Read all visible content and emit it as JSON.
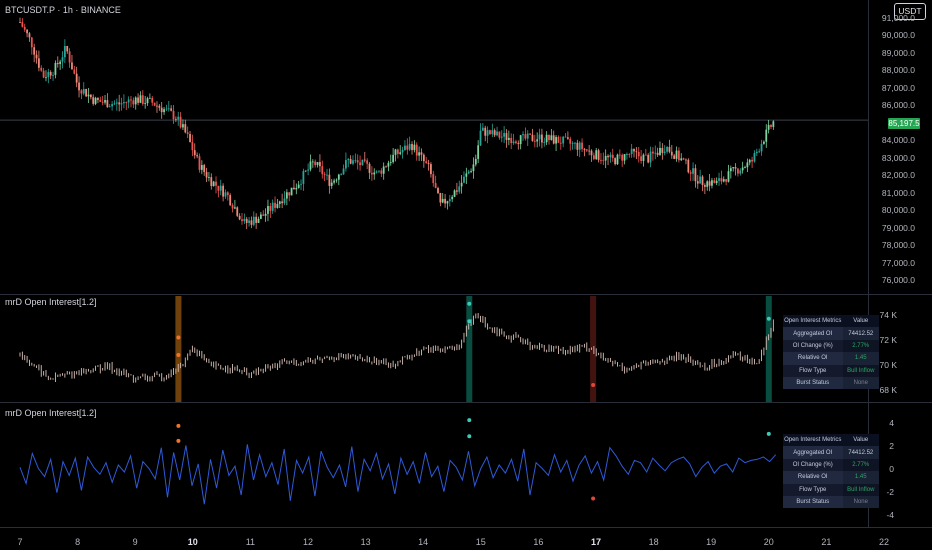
{
  "main": {
    "symbol_title": "BTCUSDT.P · 1h · BINANCE",
    "currency": "USDT",
    "last_price": "85,197.5",
    "price_ticks": [
      "91,000.0",
      "90,000.0",
      "89,000.0",
      "88,000.0",
      "87,000.0",
      "86,000.0",
      "84,000.0",
      "83,000.0",
      "82,000.0",
      "81,000.0",
      "80,000.0",
      "79,000.0",
      "78,000.0",
      "77,000.0",
      "76,000.0"
    ]
  },
  "pane1": {
    "title": "mrD Open Interest[1.2]",
    "ticks": [
      "74 K",
      "72 K",
      "70 K",
      "68 K"
    ]
  },
  "pane2": {
    "title": "mrD Open Interest[1.2]",
    "ticks": [
      "4",
      "2",
      "0",
      "-2",
      "-4"
    ]
  },
  "metrics": {
    "header_key": "Open Interest Metrics",
    "header_value": "Value",
    "rows": [
      {
        "key": "Aggregated OI",
        "value": "74412.52"
      },
      {
        "key": "OI Change (%)",
        "value": "2.77%"
      },
      {
        "key": "Relative OI",
        "value": "1.45"
      },
      {
        "key": "Flow Type",
        "value": "Bull Inflow"
      },
      {
        "key": "Burst Status",
        "value": "None"
      }
    ]
  },
  "time_axis": [
    "7",
    "8",
    "9",
    "10",
    "11",
    "12",
    "13",
    "14",
    "15",
    "16",
    "17",
    "18",
    "19",
    "20",
    "21",
    "22"
  ],
  "colors": {
    "up": "#26a69a",
    "up_light": "#7fd3a0",
    "down": "#ef5350",
    "down_light": "#f08a7a",
    "oscillator": "#2f5ad8",
    "highlight_orange": "#f7931a",
    "highlight_teal": "#14a88e",
    "highlight_red": "#c0392b",
    "marker_orange": "#f0732a",
    "marker_teal": "#3ec9b6",
    "marker_red": "#e0473a",
    "price_line": "#26a652"
  },
  "chart_data": [
    {
      "type": "candlestick",
      "title": "BTCUSDT.P · 1h · BINANCE",
      "x_dates": [
        "7",
        "8",
        "9",
        "10",
        "11",
        "12",
        "13",
        "14",
        "15",
        "16",
        "17",
        "18",
        "19",
        "20"
      ],
      "path": [
        [
          7,
          90800
        ],
        [
          7.2,
          89600
        ],
        [
          7.4,
          87700
        ],
        [
          7.6,
          88100
        ],
        [
          7.8,
          89300
        ],
        [
          8,
          87200
        ],
        [
          8.3,
          86300
        ],
        [
          8.7,
          86100
        ],
        [
          9,
          86400
        ],
        [
          9.3,
          86200
        ],
        [
          9.7,
          85400
        ],
        [
          9.9,
          84300
        ],
        [
          10.1,
          82700
        ],
        [
          10.3,
          81800
        ],
        [
          10.6,
          80900
        ],
        [
          10.9,
          79300
        ],
        [
          11.2,
          79700
        ],
        [
          11.5,
          80600
        ],
        [
          11.8,
          81500
        ],
        [
          12.1,
          82800
        ],
        [
          12.4,
          81600
        ],
        [
          12.7,
          82900
        ],
        [
          13,
          82600
        ],
        [
          13.2,
          82100
        ],
        [
          13.5,
          83200
        ],
        [
          13.8,
          83800
        ],
        [
          14.1,
          82400
        ],
        [
          14.3,
          80300
        ],
        [
          14.6,
          81300
        ],
        [
          14.9,
          82800
        ],
        [
          15,
          84600
        ],
        [
          15.3,
          84300
        ],
        [
          15.7,
          84100
        ],
        [
          16,
          84200
        ],
        [
          16.4,
          84000
        ],
        [
          16.7,
          83700
        ],
        [
          17,
          83200
        ],
        [
          17.3,
          82900
        ],
        [
          17.6,
          83300
        ],
        [
          17.9,
          83000
        ],
        [
          18.2,
          83700
        ],
        [
          18.5,
          82900
        ],
        [
          18.8,
          81700
        ],
        [
          19.1,
          81600
        ],
        [
          19.4,
          82300
        ],
        [
          19.7,
          82800
        ],
        [
          19.9,
          84100
        ],
        [
          20.1,
          85200
        ]
      ],
      "ylim": [
        75500,
        91600
      ],
      "last_price": 85197.5
    },
    {
      "type": "bar",
      "title": "mrD Open Interest[1.2]",
      "path": [
        [
          7,
          71.0
        ],
        [
          7.5,
          69.0
        ],
        [
          8,
          69.5
        ],
        [
          8.5,
          70.0
        ],
        [
          9,
          69.0
        ],
        [
          9.5,
          69.2
        ],
        [
          9.8,
          70.0
        ],
        [
          10,
          71.5
        ],
        [
          10.3,
          70.0
        ],
        [
          10.7,
          69.8
        ],
        [
          11,
          69.3
        ],
        [
          11.5,
          70.2
        ],
        [
          12,
          70.4
        ],
        [
          12.5,
          70.8
        ],
        [
          13,
          70.5
        ],
        [
          13.5,
          70.2
        ],
        [
          14,
          71.3
        ],
        [
          14.6,
          71.5
        ],
        [
          14.9,
          74.1
        ],
        [
          15.2,
          73.0
        ],
        [
          15.6,
          72.2
        ],
        [
          16,
          71.5
        ],
        [
          16.5,
          71.3
        ],
        [
          16.9,
          71.6
        ],
        [
          17.1,
          70.6
        ],
        [
          17.5,
          69.8
        ],
        [
          18,
          70.3
        ],
        [
          18.5,
          70.8
        ],
        [
          18.9,
          69.9
        ],
        [
          19.4,
          70.9
        ],
        [
          19.8,
          70.3
        ],
        [
          20.1,
          73.8
        ]
      ],
      "ylim": [
        67.3,
        75.3
      ],
      "highlights": [
        {
          "x": 9.75,
          "kind": "orange"
        },
        {
          "x": 14.8,
          "kind": "teal"
        },
        {
          "x": 16.95,
          "kind": "red"
        },
        {
          "x": 20.0,
          "kind": "teal"
        }
      ]
    },
    {
      "type": "line",
      "title": "mrD Open Interest[1.2]",
      "series": [
        {
          "values": [
            0.2,
            -1.2,
            1.4,
            0.1,
            -0.6,
            0.9,
            -2.0,
            0.7,
            -0.5,
            1.0,
            -1.8,
            1.1,
            0.2,
            -0.4,
            0.6,
            -1.1,
            0.4,
            -0.2,
            1.2,
            -1.6,
            0.7,
            0.1,
            -0.8,
            1.9,
            -2.4,
            1.5,
            -0.9,
            2.1,
            -1.4,
            0.5,
            -3.0,
            0.9,
            -1.6,
            1.7,
            -0.5,
            0.3,
            -2.2,
            2.2,
            -0.9,
            1.3,
            -0.6,
            0.6,
            -1.3,
            1.8,
            -2.7,
            0.8,
            -0.3,
            1.1,
            -2.3,
            1.6,
            0.2,
            -0.7,
            0.4,
            -1.5,
            2.0,
            -1.9,
            0.9,
            -0.1,
            1.4,
            -0.8,
            0.5,
            -2.1,
            1.0,
            -0.4,
            0.7,
            -1.2,
            1.5,
            -0.6,
            0.3,
            -1.9,
            0.8,
            0.2,
            -0.9,
            1.6,
            -1.4,
            0.1,
            1.1,
            -0.7,
            0.4,
            -0.3,
            0.9,
            -1.0,
            1.8,
            -2.2,
            0.6,
            0.1,
            -0.5,
            1.3,
            -0.2,
            0.8,
            -1.0,
            0.4,
            1.2,
            -0.3,
            0.7,
            -0.9,
            1.9,
            1.2,
            0.3,
            -0.4,
            0.8,
            0.6,
            -0.2,
            1.0,
            0.4,
            -0.1,
            0.6,
            0.9,
            1.1,
            0.5,
            -0.6,
            0.2,
            0.7,
            -0.3,
            0.3,
            0.5,
            -0.2,
            1.0,
            0.6,
            0.8,
            0.9,
            1.1,
            0.7,
            1.3
          ]
        }
      ],
      "ylim": [
        -4.8,
        5.0
      ],
      "markers": [
        {
          "x": 9.75,
          "y": 3.8,
          "kind": "orange"
        },
        {
          "x": 9.75,
          "y": 2.5,
          "kind": "orange"
        },
        {
          "x": 14.8,
          "y": 4.3,
          "kind": "teal"
        },
        {
          "x": 14.8,
          "y": 2.9,
          "kind": "teal"
        },
        {
          "x": 16.95,
          "y": -2.5,
          "kind": "red"
        },
        {
          "x": 20.0,
          "y": 3.1,
          "kind": "teal"
        }
      ]
    }
  ]
}
